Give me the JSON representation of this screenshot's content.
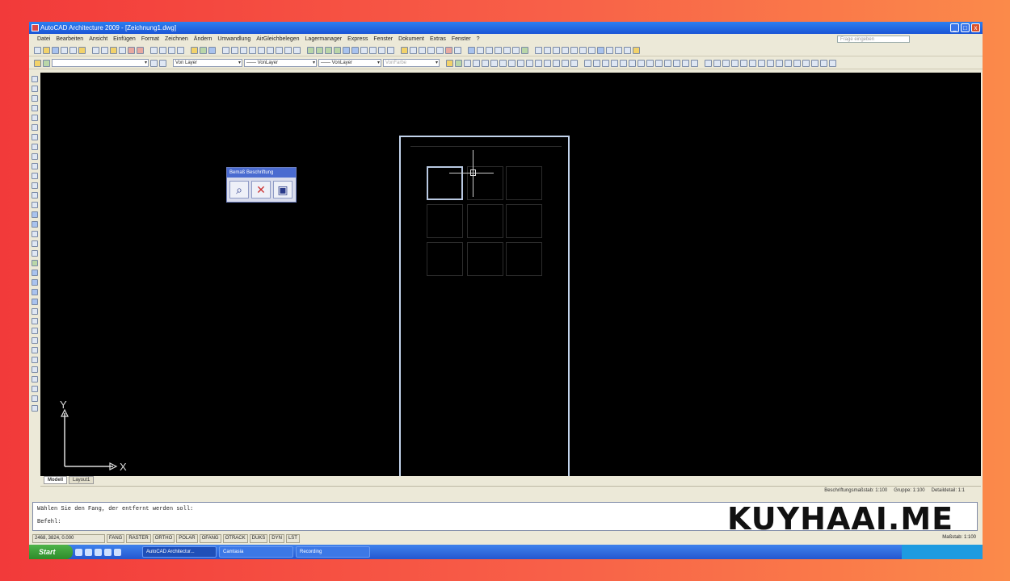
{
  "window": {
    "title": "AutoCAD Architecture 2009 - [Zeichnung1.dwg]",
    "controls": [
      "_",
      "□",
      "x"
    ]
  },
  "menubar": {
    "items": [
      "Datei",
      "Bearbeiten",
      "Ansicht",
      "Einfügen",
      "Format",
      "Zeichnen",
      "Ändern",
      "Umwandlung",
      "AirGleichbelegen",
      "Lagermanager",
      "Express",
      "Fenster",
      "Dokument",
      "Extras",
      "Fenster",
      "?"
    ],
    "help_placeholder": "Frage eingeben"
  },
  "properties_toolbar": {
    "layer_combo": "Von Layer",
    "linetype_combo": "—— VonLayer",
    "lineweight_combo": "—— VonLayer",
    "plotstyle_combo": "VonFarbe"
  },
  "floating_panel": {
    "title": "Bemaß Beschriftung",
    "buttons": [
      "zoom-icon",
      "delete-icon",
      "save-icon"
    ]
  },
  "ucs": {
    "y_label": "Y",
    "x_label": "X"
  },
  "layout_tabs": [
    "Modell",
    "Layout1"
  ],
  "status_scale": {
    "annotation_scale": "Beschriftungsmaßstab: 1:100",
    "display": "Gruppe: 1:100",
    "detail": "Detaildetail: 1:1"
  },
  "command_line": {
    "line1": "Wählen Sie den Fang, der entfernt werden soll:",
    "line2": "Befehl:"
  },
  "statusbar": {
    "coords": "2468, 3824, 0.000",
    "buttons": [
      "FANG",
      "RASTER",
      "ORTHO",
      "POLAR",
      "OFANG",
      "OTRACK",
      "DUKS",
      "DYN",
      "LST"
    ],
    "right_text": "Maßstab: 1:100"
  },
  "taskbar": {
    "start_label": "Start",
    "tasks": [
      "AutoCAD Architectur...",
      "Camtasia",
      "Recording"
    ]
  },
  "watermark": "KUYHAAI.ME"
}
